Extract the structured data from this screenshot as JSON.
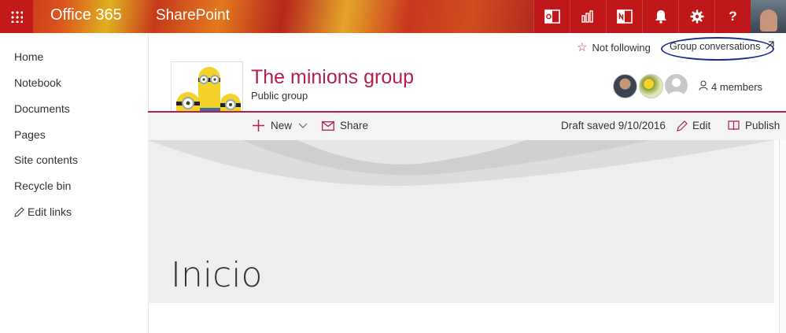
{
  "suitebar": {
    "product": "Office 365",
    "app": "SharePoint",
    "icons": [
      "outlook-icon",
      "powerbi-icon",
      "onenote-icon",
      "bell-icon",
      "gear-icon",
      "help-icon"
    ],
    "help_glyph": "?"
  },
  "nav": {
    "items": [
      "Home",
      "Notebook",
      "Documents",
      "Pages",
      "Site contents",
      "Recycle bin"
    ],
    "edit_links": "Edit links"
  },
  "header": {
    "follow": "Not following",
    "conversations": "Group conversations",
    "title": "The minions group",
    "subtitle": "Public group",
    "members": "4 members"
  },
  "commands": {
    "new": "New",
    "share": "Share",
    "draft": "Draft saved 9/10/2016",
    "edit": "Edit",
    "publish": "Publish"
  },
  "page": {
    "title": "Inicio"
  },
  "colors": {
    "accent": "#b1214a",
    "suitebar": "#c0181a"
  }
}
